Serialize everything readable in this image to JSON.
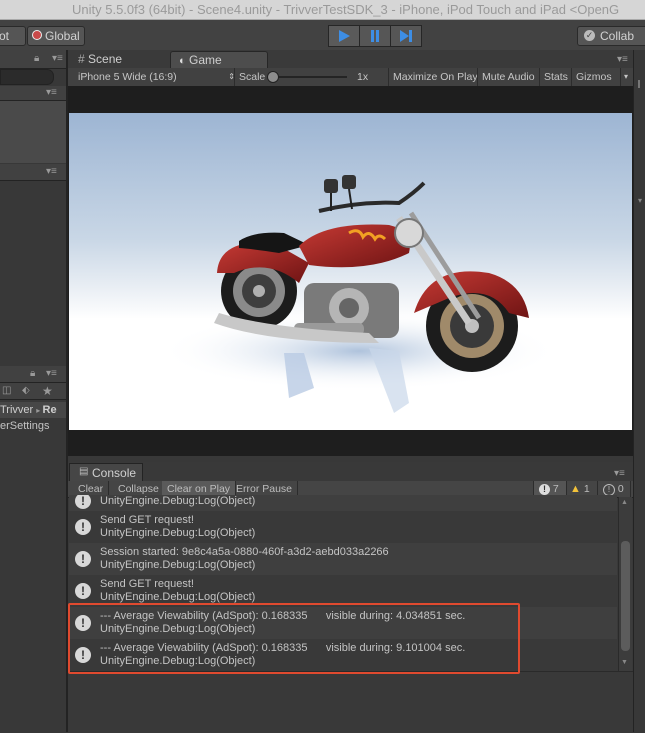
{
  "window": {
    "title": "Unity 5.5.0f3 (64bit) - Scene4.unity - TrivverTestSDK_3 - iPhone, iPod Touch and iPad <OpenG"
  },
  "toolbar": {
    "pivot_label": "ot",
    "global_label": "Global",
    "collab_label": "Collab"
  },
  "left_panel": {
    "breadcrumb_1": "Trivver",
    "breadcrumb_2": "Re",
    "item": "erSettings"
  },
  "game_view": {
    "tabs": [
      {
        "label": "Scene"
      },
      {
        "label": "Game"
      }
    ],
    "resolution": "iPhone 5 Wide (16:9)",
    "scale_label": "Scale",
    "scale_value": "1x",
    "buttons": [
      "Maximize On Play",
      "Mute Audio",
      "Stats",
      "Gizmos"
    ]
  },
  "console": {
    "tab_label": "Console",
    "buttons": [
      "Clear",
      "Collapse",
      "Clear on Play",
      "Error Pause"
    ],
    "counts": {
      "log": "7",
      "warning": "1",
      "error": "0"
    },
    "entries": [
      {
        "line1": "",
        "line2": "UnityEngine.Debug:Log(Object)"
      },
      {
        "line1": "Send GET request!",
        "line2": "UnityEngine.Debug:Log(Object)"
      },
      {
        "line1": "Session started: 9e8c4a5a-0880-460f-a3d2-aebd033a2266",
        "line2": "UnityEngine.Debug:Log(Object)"
      },
      {
        "line1": "Send GET request!",
        "line2": "UnityEngine.Debug:Log(Object)"
      },
      {
        "line1": "--- Average Viewability (AdSpot): 0.168335      visible during: 4.034851 sec.",
        "line2": "UnityEngine.Debug:Log(Object)"
      },
      {
        "line1": "--- Average Viewability (AdSpot): 0.168335      visible during: 9.101004 sec.",
        "line2": "UnityEngine.Debug:Log(Object)"
      }
    ]
  },
  "colors": {
    "highlight": "#e04a2f",
    "play_accent": "#3d8ee6"
  }
}
